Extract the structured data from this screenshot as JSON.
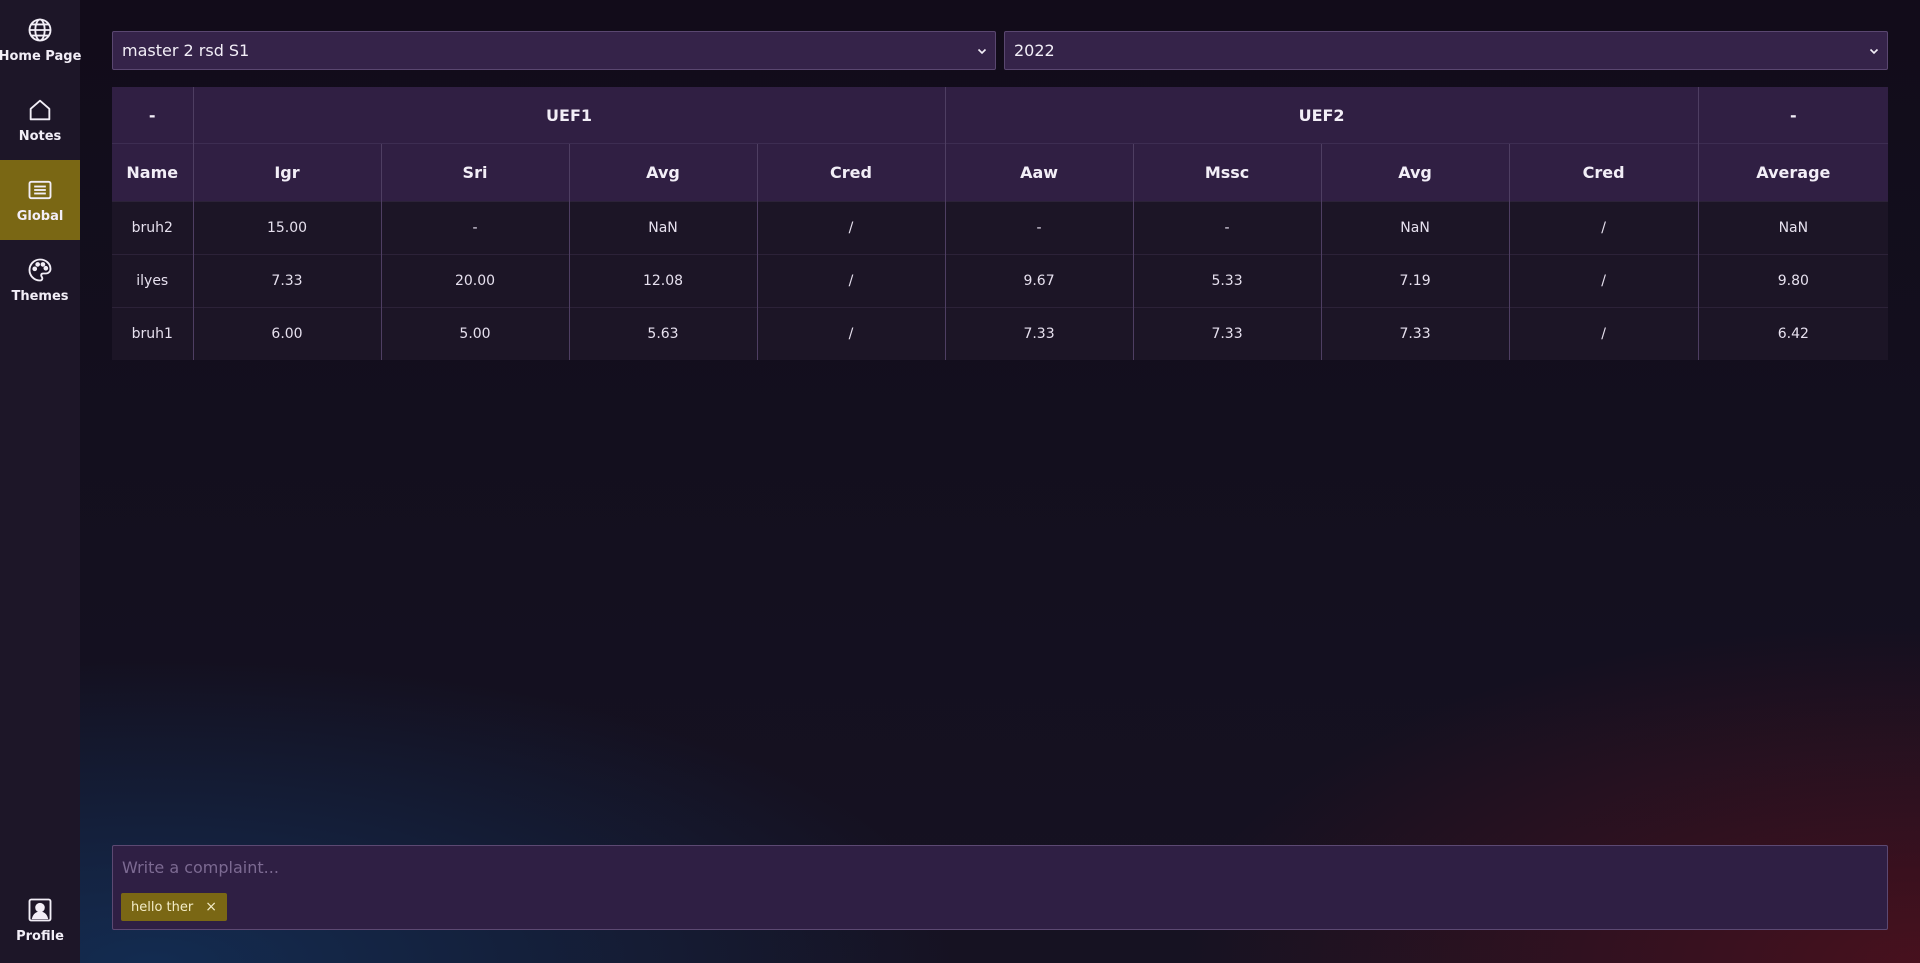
{
  "sidebar": {
    "items": [
      {
        "label": "Home Page",
        "icon": "globe-icon"
      },
      {
        "label": "Notes",
        "icon": "home-icon"
      },
      {
        "label": "Global",
        "icon": "list-icon",
        "active": true
      },
      {
        "label": "Themes",
        "icon": "palette-icon"
      }
    ],
    "profile": {
      "label": "Profile",
      "icon": "user-icon"
    }
  },
  "filters": {
    "program": "master 2 rsd S1",
    "year": "2022"
  },
  "table": {
    "groups": [
      "-",
      "UEF1",
      "UEF2",
      "-"
    ],
    "columns": [
      "Name",
      "Igr",
      "Sri",
      "Avg",
      "Cred",
      "Aaw",
      "Mssc",
      "Avg",
      "Cred",
      "Average"
    ],
    "rows": [
      [
        "bruh2",
        "15.00",
        "-",
        "NaN",
        "/",
        "-",
        "-",
        "NaN",
        "/",
        "NaN"
      ],
      [
        "ilyes",
        "7.33",
        "20.00",
        "12.08",
        "/",
        "9.67",
        "5.33",
        "7.19",
        "/",
        "9.80"
      ],
      [
        "bruh1",
        "6.00",
        "5.00",
        "5.63",
        "/",
        "7.33",
        "7.33",
        "7.33",
        "/",
        "6.42"
      ]
    ]
  },
  "complaint": {
    "placeholder": "Write a complaint...",
    "tag": "hello ther",
    "tag_remove": "×"
  },
  "colors": {
    "accent": "#7a6714",
    "sidebar_bg": "#1d1628",
    "header_bg": "#301f43",
    "row_bg": "#1c1526"
  }
}
